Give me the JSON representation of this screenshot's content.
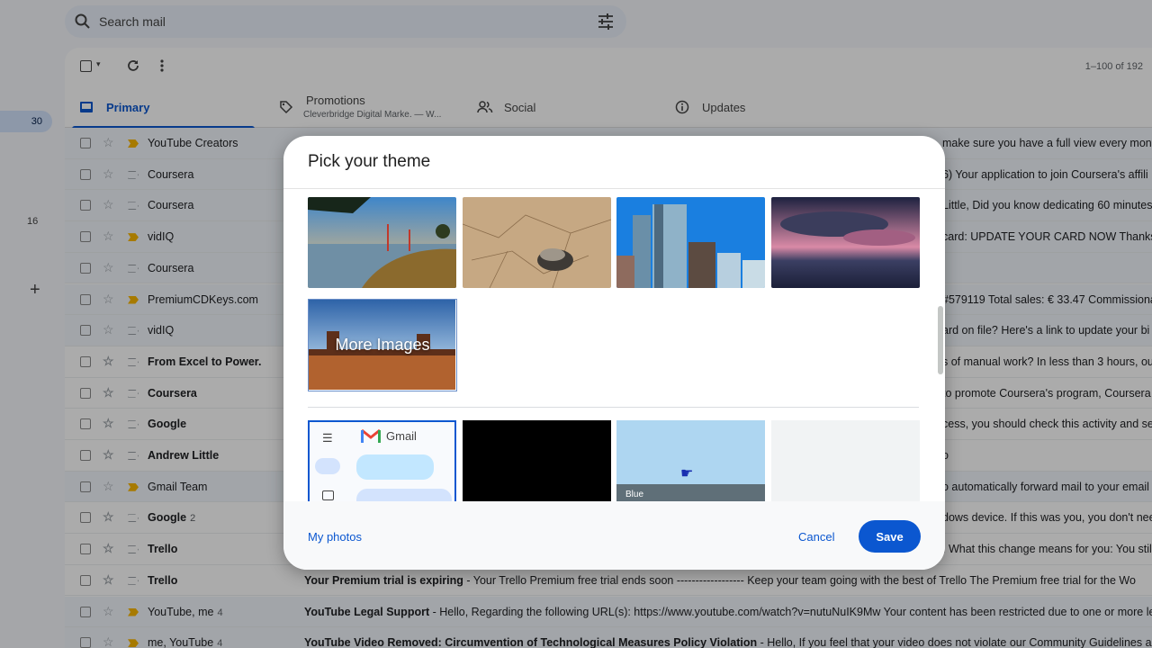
{
  "search": {
    "placeholder": "Search mail"
  },
  "rail": {
    "badge_primary": "30",
    "badge_other": "16",
    "plus": "+"
  },
  "toolbar": {
    "count": "1–100 of 192"
  },
  "tabs": [
    {
      "label": "Primary"
    },
    {
      "label": "Promotions",
      "sub": "Cleverbridge Digital Marke. — W..."
    },
    {
      "label": "Social"
    },
    {
      "label": "Updates"
    }
  ],
  "rows": [
    {
      "sender": "YouTube Creators",
      "count": "",
      "snippet": "",
      "right": "make sure you have a full view every month"
    },
    {
      "sender": "Coursera",
      "count": "",
      "snippet": "",
      "right": "6) Your application to join Coursera's affili"
    },
    {
      "sender": "Coursera",
      "count": "",
      "snippet": "",
      "right": "Little, Did you know dedicating 60 minutes"
    },
    {
      "sender": "vidIQ",
      "count": "",
      "snippet": "",
      "right": "card: UPDATE YOUR CARD NOW Thanks! Tr"
    },
    {
      "sender": "Coursera",
      "count": "",
      "snippet": "",
      "right": ""
    },
    {
      "sender": "PremiumCDKeys.com",
      "count": "",
      "snippet": "",
      "right": "#579119 Total sales: € 33.47 Commissiona"
    },
    {
      "sender": "vidIQ",
      "count": "",
      "snippet": "",
      "right": "ard on file? Here's a link to update your bi"
    },
    {
      "sender": "From Excel to Power.",
      "count": "",
      "snippet": "",
      "right": "s of manual work? In less than 3 hours, ou"
    },
    {
      "sender": "Coursera",
      "count": "",
      "snippet": "",
      "right": "to promote Coursera's program, Coursera"
    },
    {
      "sender": "Google",
      "count": "",
      "snippet": "",
      "right": "cess, you should check this activity and se"
    },
    {
      "sender": "Andrew Little",
      "count": "",
      "snippet": "",
      "right": "o"
    },
    {
      "sender": "Gmail Team",
      "count": "",
      "snippet": "",
      "right": "o automatically forward mail to your email"
    },
    {
      "sender": "Google",
      "count": "2",
      "snippet": "",
      "right": "dows device. If this was you, you don't nee"
    },
    {
      "sender": "Trello",
      "count": "",
      "snippet": "",
      "right": ". What this change means for you: You stil"
    },
    {
      "sender": "Trello",
      "count": "",
      "subject": "Your Premium trial is expiring",
      "snippet": " - Your Trello Premium free trial ends soon ------------------ Keep your team going with the best of Trello The Premium free trial for the Wo",
      "right": ""
    },
    {
      "sender": "YouTube, me",
      "count": "4",
      "subject": "YouTube Legal Support",
      "snippet": " - Hello, Regarding the following URL(s): https://www.youtube.com/watch?v=nutuNuIK9Mw Your content has been restricted due to one or more legal",
      "right": ""
    },
    {
      "sender": "me, YouTube",
      "count": "4",
      "subject": "YouTube Video Removed: Circumvention of Technological Measures Policy Violation",
      "snippet": " - Hello, If you feel that your video does not violate our Community Guidelines and was s",
      "right": ""
    }
  ],
  "modal": {
    "title": "Pick your theme",
    "more_images": "More Images",
    "gmail_label": "Gmail",
    "blue_label": "Blue",
    "my_photos": "My photos",
    "cancel": "Cancel",
    "save": "Save"
  },
  "colors": {
    "accent": "#0b57d0",
    "important": "#f9b600"
  }
}
